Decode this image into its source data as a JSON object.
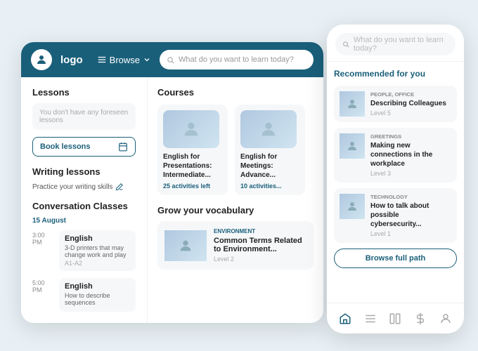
{
  "app": {
    "logo_text": "logo",
    "browse_label": "Browse",
    "search_placeholder": "What do you want to learn today?"
  },
  "left_panel": {
    "lessons_title": "Lessons",
    "no_lessons_text": "You don't have any foreseen lessons",
    "book_btn_label": "Book lessons",
    "writing_title": "Writing lessons",
    "writing_subtitle": "Practice your writing skills",
    "conv_title": "Conversation Classes",
    "date_label": "15 August",
    "classes": [
      {
        "time": "3:00 PM",
        "title": "English",
        "desc": "3-D printers that may change work and play",
        "level": "A1-A2"
      },
      {
        "time": "5:00 PM",
        "title": "English",
        "desc": "How to describe sequences",
        "level": ""
      }
    ]
  },
  "right_panel": {
    "courses_title": "Courses",
    "courses": [
      {
        "name": "English for Presentations: Intermediate...",
        "activities": "25 activities left"
      },
      {
        "name": "English for Meetings: Advance...",
        "activities": "10 activities..."
      }
    ],
    "vocab_title": "Grow your vocabulary",
    "vocab_item": {
      "tag": "ENVIRONMENT",
      "title": "Common Terms Related to Environment...",
      "level": "Level 2"
    }
  },
  "mobile": {
    "search_placeholder": "What do you want to learn today?",
    "recommended_title": "Recommended for you",
    "recommendations": [
      {
        "tag": "PEOPLE, OFFICE",
        "title": "Describing Colleagues",
        "level": "Level 5"
      },
      {
        "tag": "GREETINGS",
        "title": "Making new connections in the workplace",
        "level": "Level 3"
      },
      {
        "tag": "TECHNOLOGY",
        "title": "How to talk about possible cybersecurity...",
        "level": "Level 1"
      }
    ],
    "browse_path_label": "Browse full path"
  }
}
